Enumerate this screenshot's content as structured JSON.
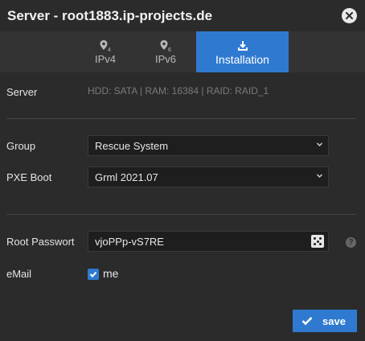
{
  "dialog": {
    "title": "Server - root1883.ip-projects.de"
  },
  "tabs": [
    {
      "label": "IPv4",
      "icon": "location-pin-4-icon",
      "active": false
    },
    {
      "label": "IPv6",
      "icon": "location-pin-6-icon",
      "active": false
    },
    {
      "label": "Installation",
      "icon": "download-icon",
      "active": true
    }
  ],
  "form": {
    "server_label": "Server",
    "server_info": "HDD: SATA | RAM: 16384 | RAID: RAID_1",
    "group_label": "Group",
    "group_value": "Rescue System",
    "pxe_label": "PXE Boot",
    "pxe_value": "Grml 2021.07",
    "password_label": "Root Passwort",
    "password_value": "vjoPPp-vS7RE",
    "email_label": "eMail",
    "email_checkbox_label": "me",
    "email_checked": true
  },
  "actions": {
    "save_label": "save"
  },
  "colors": {
    "accent": "#2f7ad0",
    "background": "#2b2b2b",
    "tabbar": "#333333",
    "input": "#1e1e1e"
  }
}
